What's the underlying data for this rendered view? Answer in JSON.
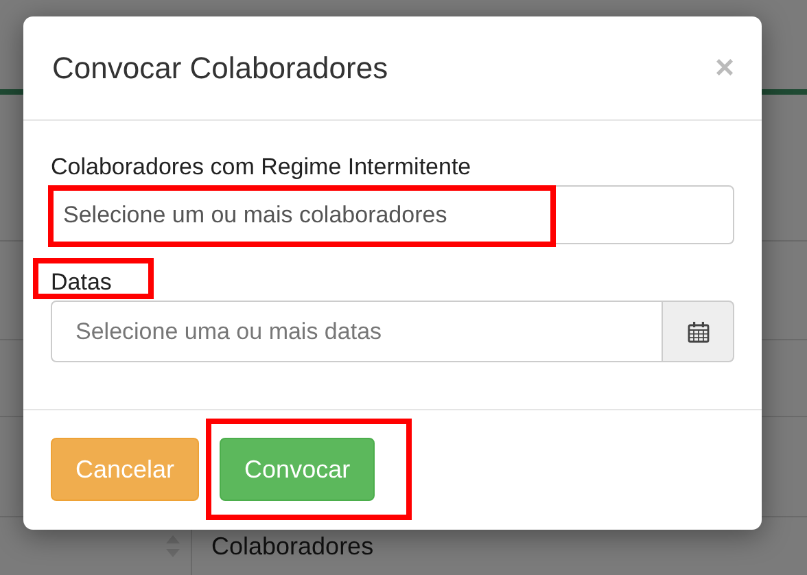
{
  "background": {
    "table_header": "Colaboradores"
  },
  "modal": {
    "title": "Convocar Colaboradores",
    "close": "×",
    "fields": [
      {
        "label": "Colaboradores com Regime Intermitente",
        "placeholder": "Selecione um ou mais colaboradores",
        "kind": "multiselect",
        "label_highlighted": false,
        "input_highlighted": true
      },
      {
        "label": "Datas",
        "placeholder": "Selecione uma ou mais datas",
        "kind": "date",
        "label_highlighted": true,
        "input_highlighted": false
      }
    ],
    "buttons": [
      {
        "label": "Cancelar",
        "kind": "warning",
        "highlighted": false
      },
      {
        "label": "Convocar",
        "kind": "success",
        "highlighted": true
      }
    ]
  }
}
